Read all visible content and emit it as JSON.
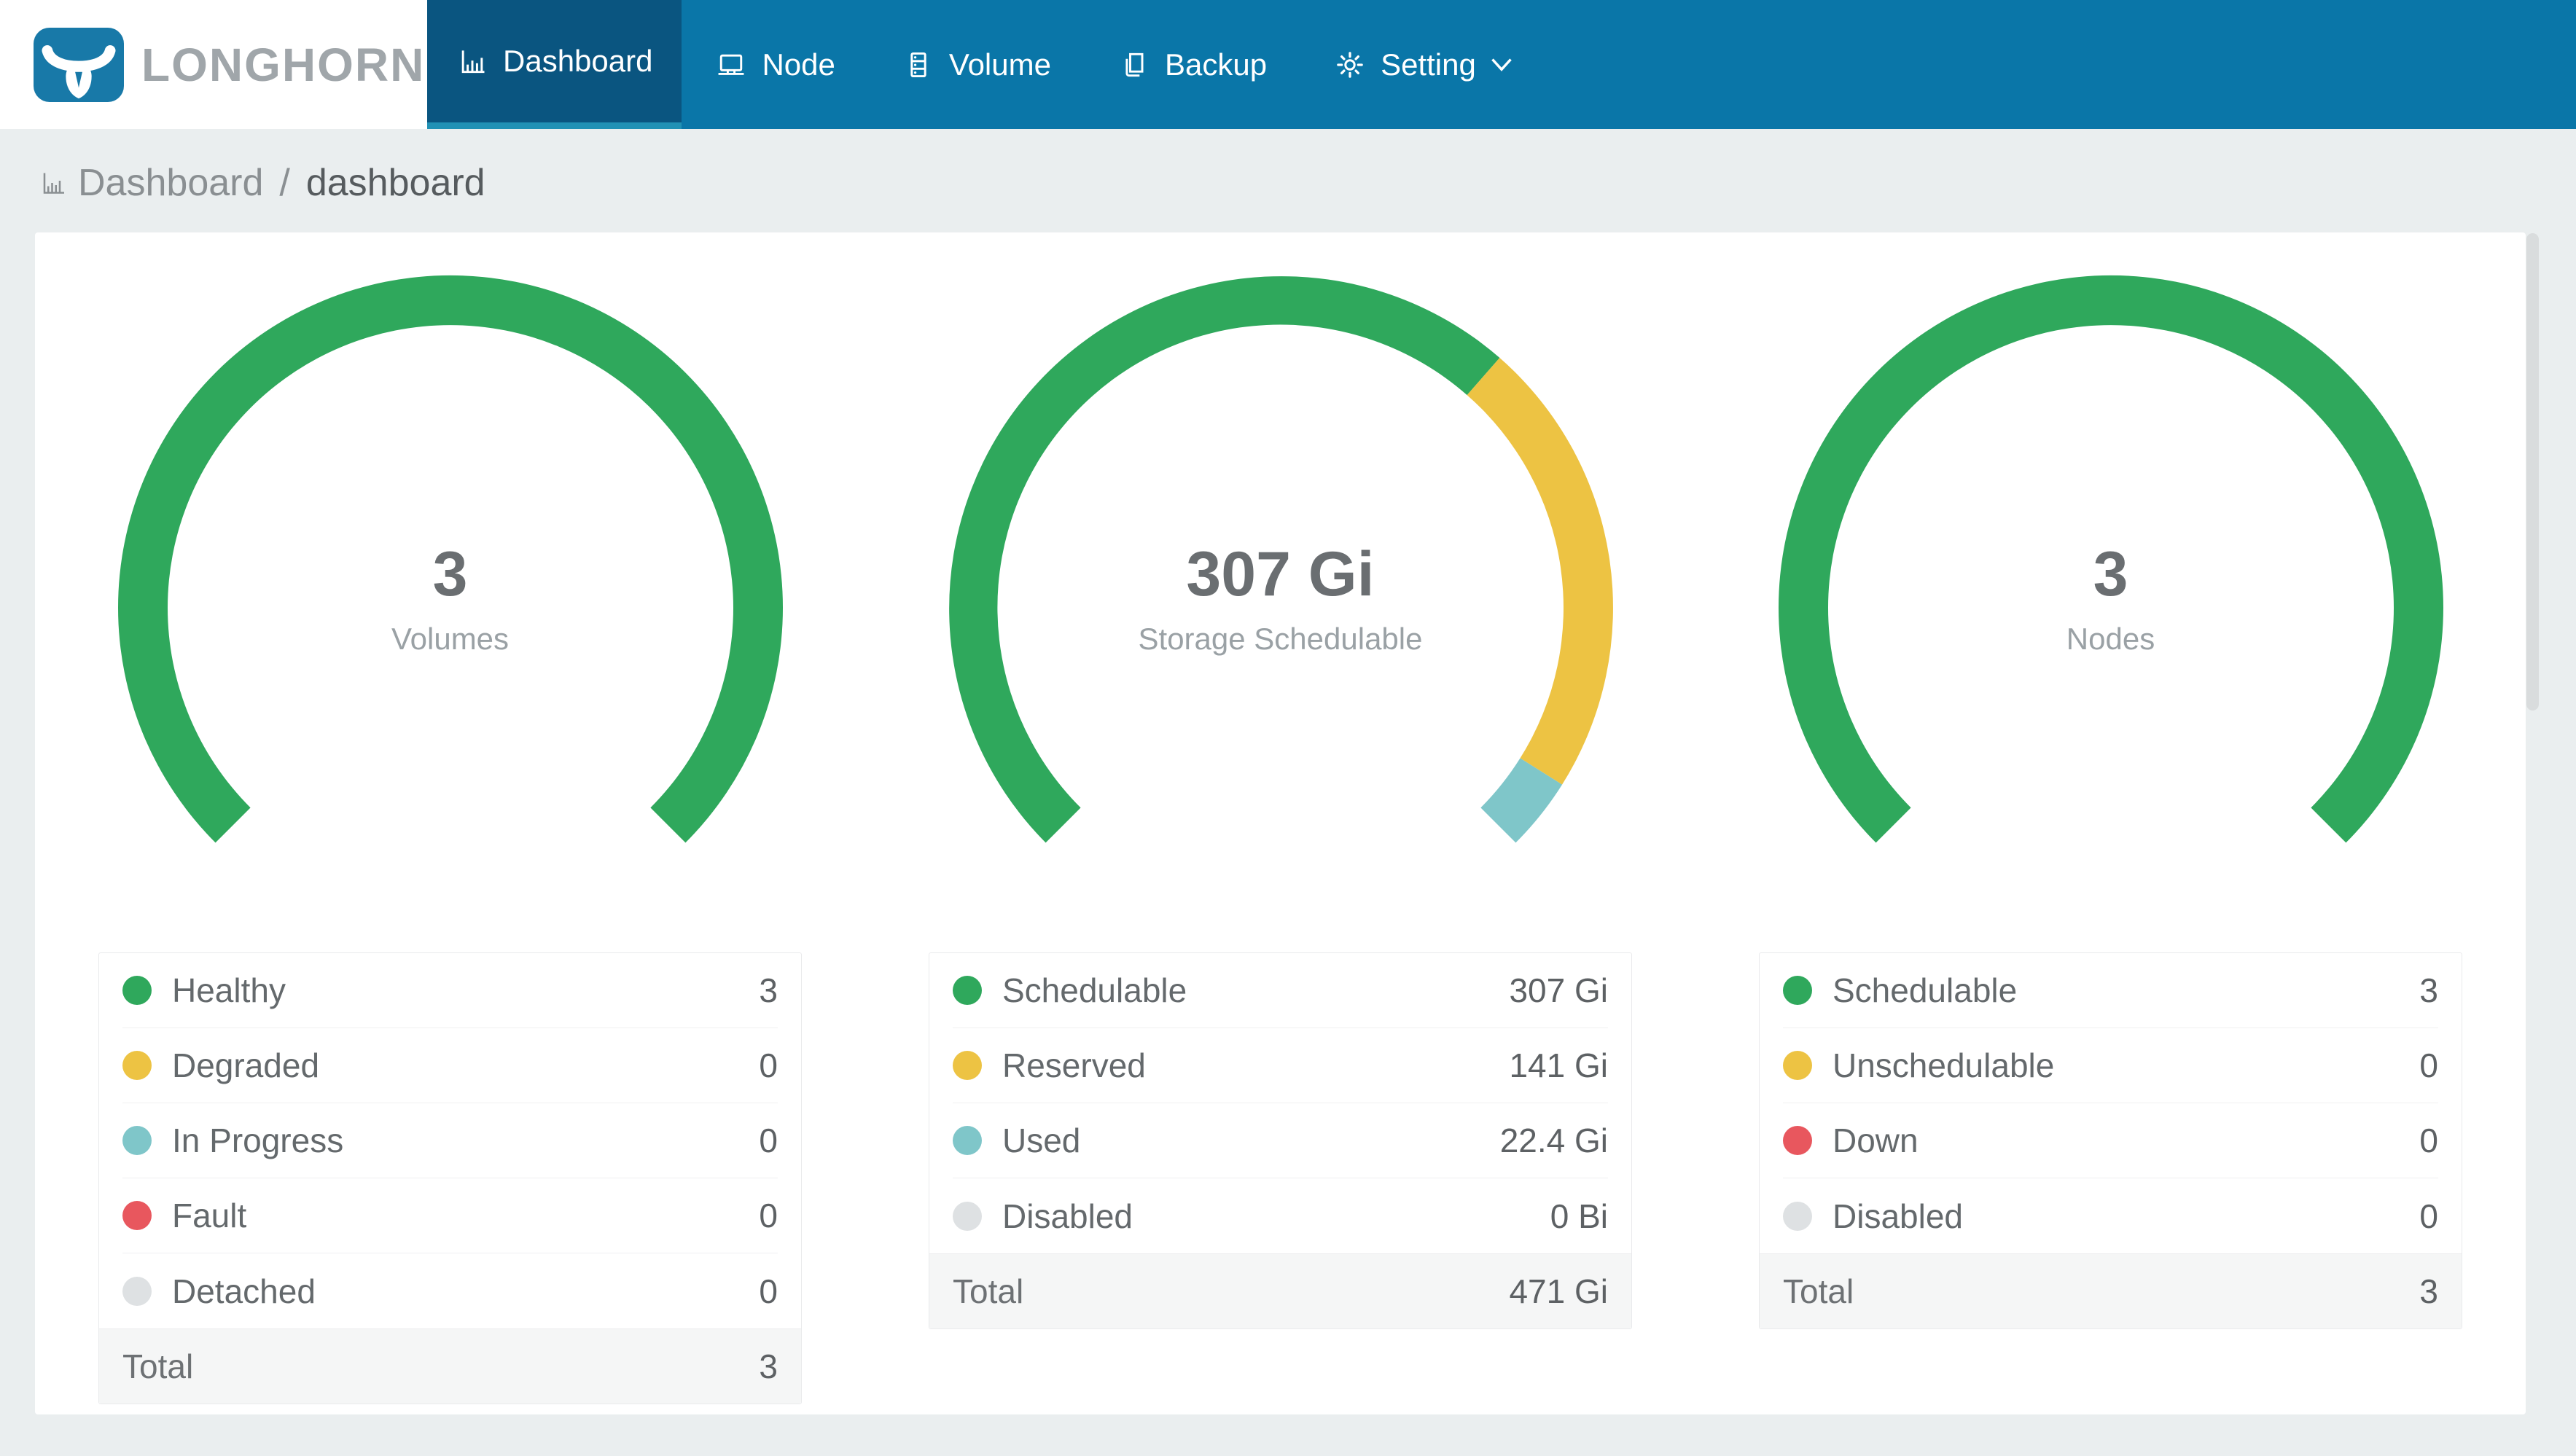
{
  "app": {
    "brand": "LONGHORN"
  },
  "nav": {
    "items": [
      {
        "label": "Dashboard",
        "icon": "chart-bar-icon",
        "active": true
      },
      {
        "label": "Node",
        "icon": "laptop-icon",
        "active": false
      },
      {
        "label": "Volume",
        "icon": "server-icon",
        "active": false
      },
      {
        "label": "Backup",
        "icon": "copy-icon",
        "active": false
      },
      {
        "label": "Setting",
        "icon": "gear-icon",
        "active": false,
        "has_caret": true
      }
    ]
  },
  "breadcrumb": {
    "section": "Dashboard",
    "separator": "/",
    "page": "dashboard"
  },
  "colors": {
    "nav_bg": "#0a76a8",
    "nav_active_bg": "#0a5580",
    "nav_active_underline": "#2191b5",
    "brand_blue": "#1879a8",
    "green": "#2fa85c",
    "yellow": "#edc343",
    "teal": "#7fc6c9",
    "red": "#e8575e",
    "gray": "#dee1e3",
    "page_bg": "#eaeeef"
  },
  "chart_data": [
    {
      "type": "gauge-donut",
      "title": "3",
      "subtitle": "Volumes",
      "start_azimuth_deg": 225,
      "sweep_deg": 270,
      "segments": [
        {
          "label": "Healthy",
          "value": 3,
          "display": "3",
          "color": "#2fa85c"
        },
        {
          "label": "Degraded",
          "value": 0,
          "display": "0",
          "color": "#edc343"
        },
        {
          "label": "In Progress",
          "value": 0,
          "display": "0",
          "color": "#7fc6c9"
        },
        {
          "label": "Fault",
          "value": 0,
          "display": "0",
          "color": "#e8575e"
        },
        {
          "label": "Detached",
          "value": 0,
          "display": "0",
          "color": "#dee1e3"
        }
      ],
      "total": {
        "label": "Total",
        "value": 3,
        "display": "3"
      }
    },
    {
      "type": "gauge-donut",
      "title": "307 Gi",
      "subtitle": "Storage Schedulable",
      "start_azimuth_deg": 225,
      "sweep_deg": 270,
      "segments": [
        {
          "label": "Schedulable",
          "value": 307,
          "display": "307 Gi",
          "color": "#2fa85c"
        },
        {
          "label": "Reserved",
          "value": 141,
          "display": "141 Gi",
          "color": "#edc343"
        },
        {
          "label": "Used",
          "value": 22.4,
          "display": "22.4 Gi",
          "color": "#7fc6c9"
        },
        {
          "label": "Disabled",
          "value": 0,
          "display": "0 Bi",
          "color": "#dee1e3"
        }
      ],
      "total": {
        "label": "Total",
        "value": 471,
        "display": "471 Gi"
      }
    },
    {
      "type": "gauge-donut",
      "title": "3",
      "subtitle": "Nodes",
      "start_azimuth_deg": 225,
      "sweep_deg": 270,
      "segments": [
        {
          "label": "Schedulable",
          "value": 3,
          "display": "3",
          "color": "#2fa85c"
        },
        {
          "label": "Unschedulable",
          "value": 0,
          "display": "0",
          "color": "#edc343"
        },
        {
          "label": "Down",
          "value": 0,
          "display": "0",
          "color": "#e8575e"
        },
        {
          "label": "Disabled",
          "value": 0,
          "display": "0",
          "color": "#dee1e3"
        }
      ],
      "total": {
        "label": "Total",
        "value": 3,
        "display": "3"
      }
    }
  ]
}
